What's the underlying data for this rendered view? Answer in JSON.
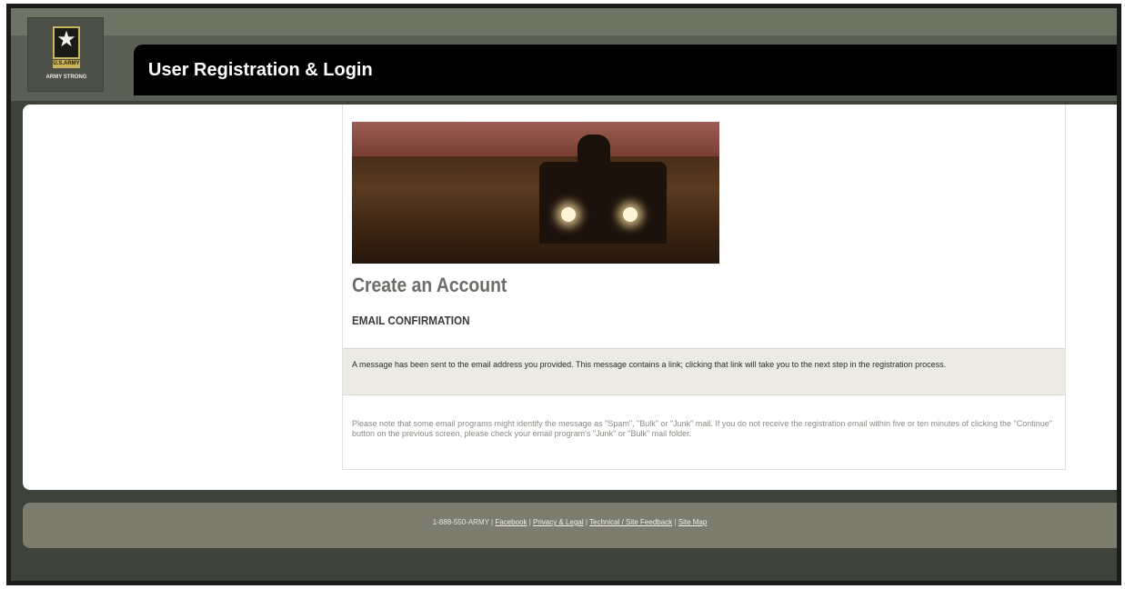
{
  "header": {
    "title": "User Registration & Login",
    "logo": {
      "icon": "army-star-icon",
      "line1": "U.S.ARMY",
      "line2": "ARMY STRONG"
    }
  },
  "main": {
    "heading": "Create an Account",
    "subheading": "EMAIL CONFIRMATION",
    "message": "A message has been sent to the email address you provided. This message contains a link; clicking that link will take you to the next step in the registration process.",
    "note": "Please note that some email programs might identify the message as \"Spam\", \"Bulk\" or \"Junk\" mail. If you do not receive the registration email within five or ten minutes of clicking the \"Continue\" button on the previous screen, please check your email program's \"Junk\" or \"Bulk\" mail folder."
  },
  "footer": {
    "phone": "1-888-550-ARMY",
    "links": [
      "Facebook",
      "Privacy & Legal",
      "Technical / Site Feedback",
      "Site Map"
    ],
    "separator": "|"
  },
  "colors": {
    "frame": "#1a1c19",
    "header": "#5a5f54",
    "title_bar": "#000000",
    "footer": "#7c7d6f",
    "message_bg": "#ebebe4"
  }
}
